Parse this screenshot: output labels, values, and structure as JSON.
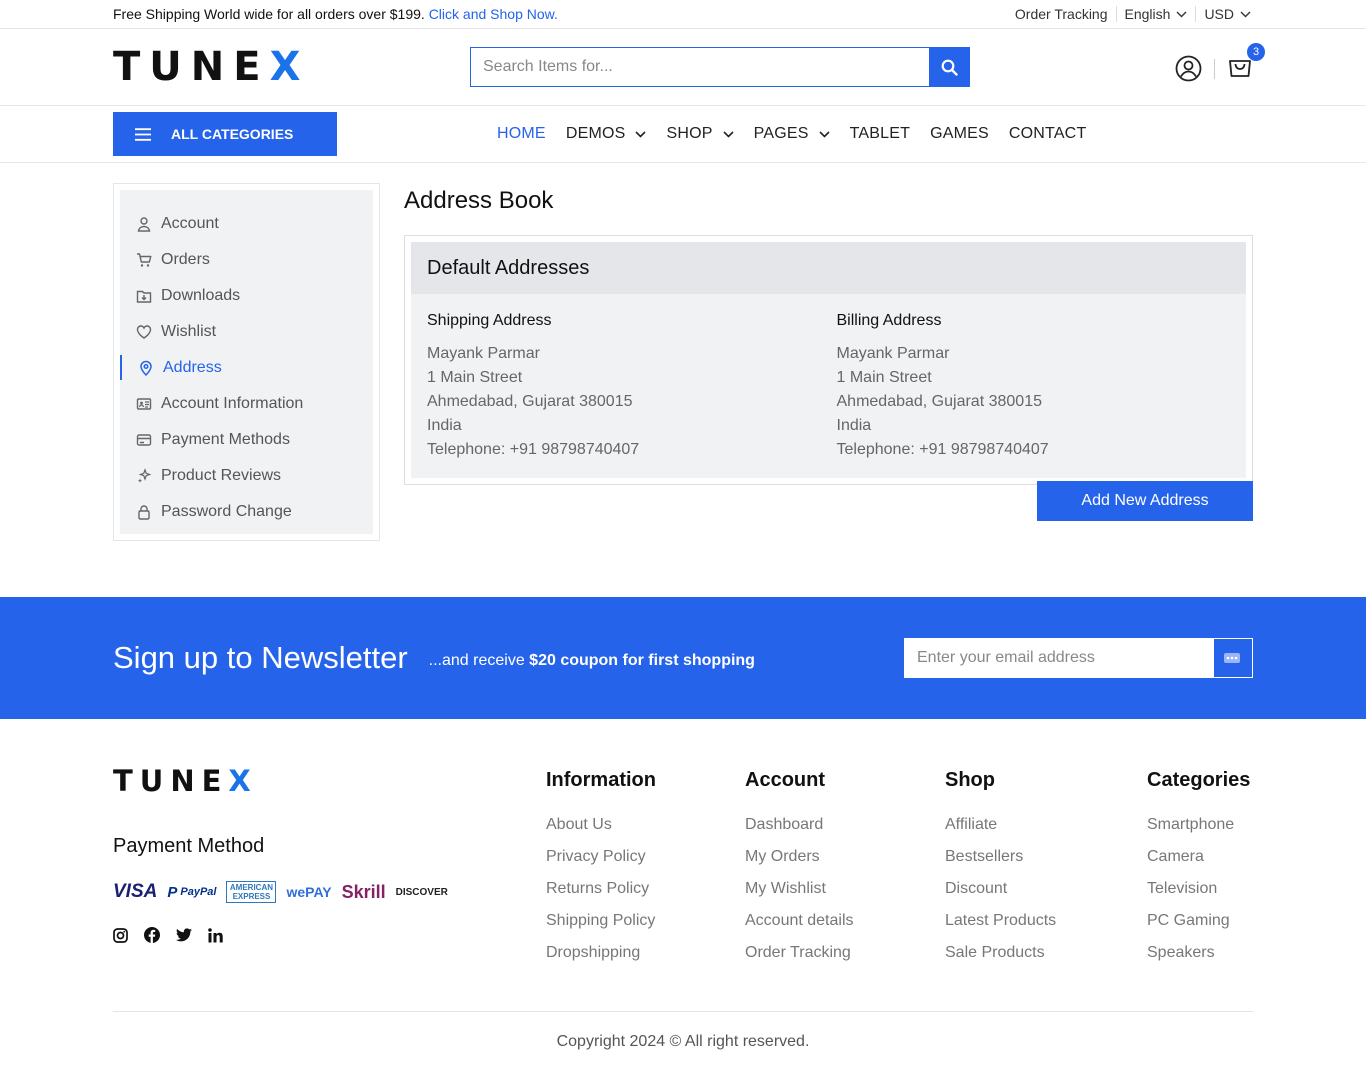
{
  "topbar": {
    "promo_text": "Free Shipping World wide for all orders over $199.",
    "promo_link": "Click and Shop Now.",
    "order_tracking": "Order Tracking",
    "language": "English",
    "currency": "USD"
  },
  "header": {
    "logo_main": "TUNE",
    "logo_accent": "X",
    "search_placeholder": "Search Items for...",
    "cart_count": "3"
  },
  "nav": {
    "all_categories": "ALL CATEGORIES",
    "items": [
      {
        "label": "HOME",
        "dropdown": false,
        "active": true
      },
      {
        "label": "DEMOS",
        "dropdown": true
      },
      {
        "label": "SHOP",
        "dropdown": true
      },
      {
        "label": "PAGES",
        "dropdown": true
      },
      {
        "label": "TABLET",
        "dropdown": false
      },
      {
        "label": "GAMES",
        "dropdown": false
      },
      {
        "label": "CONTACT",
        "dropdown": false
      }
    ]
  },
  "sidebar": {
    "items": [
      {
        "label": "Account",
        "icon": "user-icon"
      },
      {
        "label": "Orders",
        "icon": "cart-icon"
      },
      {
        "label": "Downloads",
        "icon": "download-folder-icon"
      },
      {
        "label": "Wishlist",
        "icon": "heart-icon"
      },
      {
        "label": "Address",
        "icon": "location-pin-icon",
        "active": true
      },
      {
        "label": "Account Information",
        "icon": "id-card-icon"
      },
      {
        "label": "Payment Methods",
        "icon": "credit-card-icon"
      },
      {
        "label": "Product Reviews",
        "icon": "sparkle-icon"
      },
      {
        "label": "Password Change",
        "icon": "lock-icon"
      }
    ]
  },
  "main": {
    "title": "Address Book",
    "box_title": "Default Addresses",
    "shipping": {
      "title": "Shipping Address",
      "name": "Mayank Parmar",
      "street": "1 Main Street",
      "city": "Ahmedabad, Gujarat 380015",
      "country": "India",
      "phone": "Telephone: +91 98798740407"
    },
    "billing": {
      "title": "Billing Address",
      "name": "Mayank Parmar",
      "street": "1 Main Street",
      "city": "Ahmedabad, Gujarat 380015",
      "country": "India",
      "phone": "Telephone: +91 98798740407"
    },
    "add_button": "Add New Address"
  },
  "newsletter": {
    "title": "Sign up to Newsletter",
    "sub_prefix": "...and receive",
    "sub_bold": "$20 coupon for first shopping",
    "placeholder": "Enter your email address"
  },
  "footer": {
    "payment_title": "Payment Method",
    "cards": {
      "visa": "VISA",
      "paypal": "PayPal",
      "amex": "AMERICAN EXPRESS",
      "wepay": "wePAY",
      "skrill": "Skrill",
      "discover": "DISCOVER"
    },
    "columns": [
      {
        "title": "Information",
        "links": [
          "About Us",
          "Privacy Policy",
          "Returns Policy",
          "Shipping Policy",
          "Dropshipping"
        ]
      },
      {
        "title": "Account",
        "links": [
          "Dashboard",
          "My Orders",
          "My Wishlist",
          "Account details",
          "Order Tracking"
        ]
      },
      {
        "title": "Shop",
        "links": [
          "Affiliate",
          "Bestsellers",
          "Discount",
          "Latest Products",
          "Sale Products"
        ]
      },
      {
        "title": "Categories",
        "links": [
          "Smartphone",
          "Camera",
          "Television",
          "PC Gaming",
          "Speakers"
        ]
      }
    ],
    "copyright": "Copyright 2024 © All right reserved."
  },
  "colors": {
    "accent": "#2563eb",
    "logo_x": "#1a73e8"
  }
}
